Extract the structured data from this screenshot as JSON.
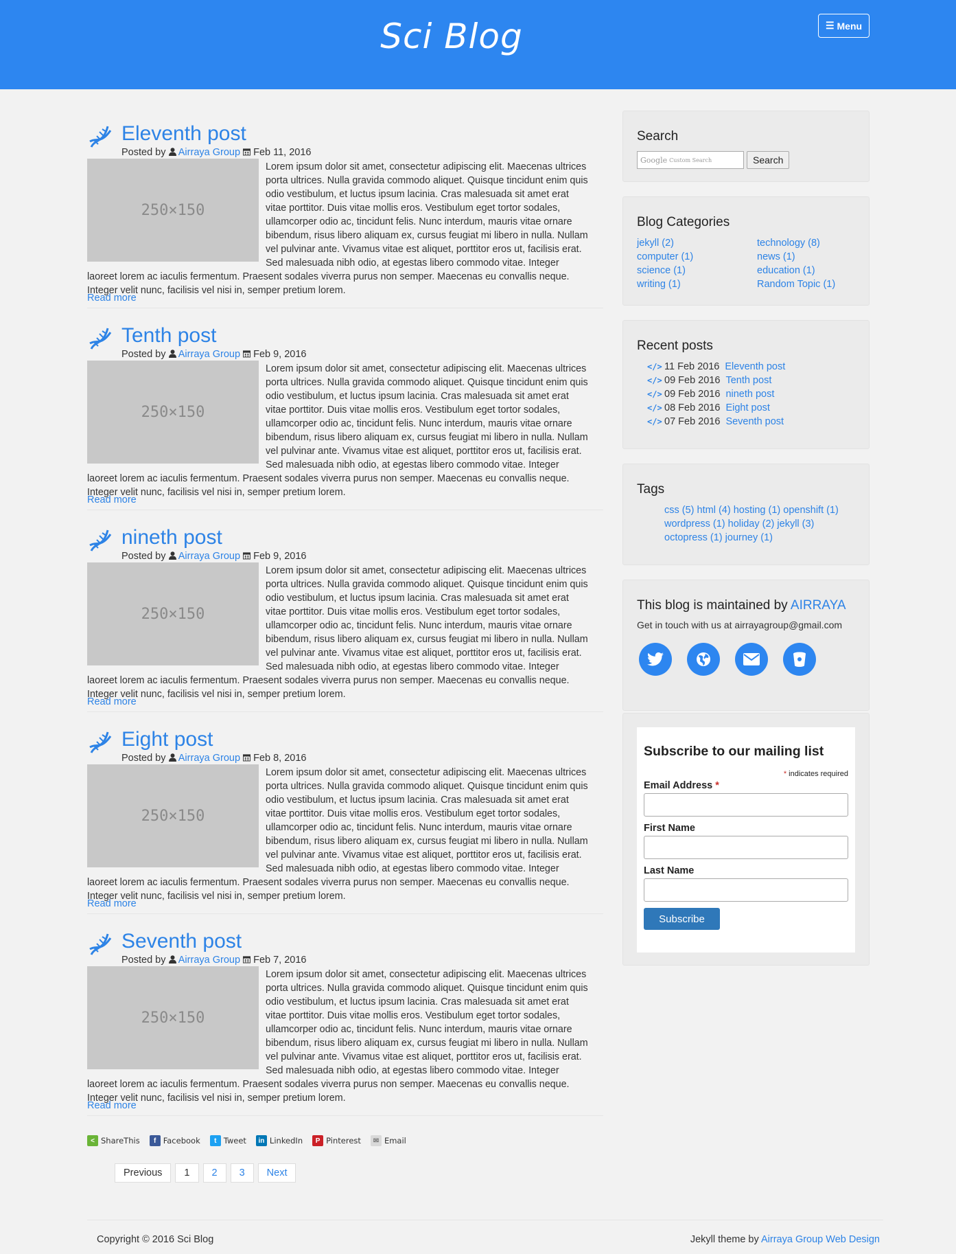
{
  "header": {
    "brand": "Sci Blog",
    "menu_label": "Menu"
  },
  "posts": [
    {
      "title": "Eleventh post",
      "posted_by_label": "Posted by",
      "author": "Airraya Group",
      "date": "Feb 11, 2016",
      "thumb_text": "250×150",
      "excerpt": "Lorem ipsum dolor sit amet, consectetur adipiscing elit. Maecenas ultrices porta ultrices. Nulla gravida commodo aliquet. Quisque tincidunt enim quis odio vestibulum, et luctus ipsum lacinia. Cras malesuada sit amet erat vitae porttitor. Duis vitae mollis eros. Vestibulum eget tortor sodales, ullamcorper odio ac, tincidunt felis. Nunc interdum, mauris vitae ornare bibendum, risus libero aliquam ex, cursus feugiat mi libero in nulla. Nullam vel pulvinar ante. Vivamus vitae est aliquet, porttitor eros ut, facilisis erat. Sed malesuada nibh odio, at egestas libero commodo vitae. Integer laoreet lorem ac iaculis fermentum. Praesent sodales viverra purus non semper. Maecenas eu convallis neque. Integer velit nunc, facilisis vel nisi in, semper pretium lorem.",
      "read_more": "Read more"
    },
    {
      "title": "Tenth post",
      "posted_by_label": "Posted by",
      "author": "Airraya Group",
      "date": "Feb 9, 2016",
      "thumb_text": "250×150",
      "excerpt": "Lorem ipsum dolor sit amet, consectetur adipiscing elit. Maecenas ultrices porta ultrices. Nulla gravida commodo aliquet. Quisque tincidunt enim quis odio vestibulum, et luctus ipsum lacinia. Cras malesuada sit amet erat vitae porttitor. Duis vitae mollis eros. Vestibulum eget tortor sodales, ullamcorper odio ac, tincidunt felis. Nunc interdum, mauris vitae ornare bibendum, risus libero aliquam ex, cursus feugiat mi libero in nulla. Nullam vel pulvinar ante. Vivamus vitae est aliquet, porttitor eros ut, facilisis erat. Sed malesuada nibh odio, at egestas libero commodo vitae. Integer laoreet lorem ac iaculis fermentum. Praesent sodales viverra purus non semper. Maecenas eu convallis neque. Integer velit nunc, facilisis vel nisi in, semper pretium lorem.",
      "read_more": "Read more"
    },
    {
      "title": "nineth post",
      "posted_by_label": "Posted by",
      "author": "Airraya Group",
      "date": "Feb 9, 2016",
      "thumb_text": "250×150",
      "excerpt": "Lorem ipsum dolor sit amet, consectetur adipiscing elit. Maecenas ultrices porta ultrices. Nulla gravida commodo aliquet. Quisque tincidunt enim quis odio vestibulum, et luctus ipsum lacinia. Cras malesuada sit amet erat vitae porttitor. Duis vitae mollis eros. Vestibulum eget tortor sodales, ullamcorper odio ac, tincidunt felis. Nunc interdum, mauris vitae ornare bibendum, risus libero aliquam ex, cursus feugiat mi libero in nulla. Nullam vel pulvinar ante. Vivamus vitae est aliquet, porttitor eros ut, facilisis erat. Sed malesuada nibh odio, at egestas libero commodo vitae. Integer laoreet lorem ac iaculis fermentum. Praesent sodales viverra purus non semper. Maecenas eu convallis neque. Integer velit nunc, facilisis vel nisi in, semper pretium lorem.",
      "read_more": "Read more"
    },
    {
      "title": "Eight post",
      "posted_by_label": "Posted by",
      "author": "Airraya Group",
      "date": "Feb 8, 2016",
      "thumb_text": "250×150",
      "excerpt": "Lorem ipsum dolor sit amet, consectetur adipiscing elit. Maecenas ultrices porta ultrices. Nulla gravida commodo aliquet. Quisque tincidunt enim quis odio vestibulum, et luctus ipsum lacinia. Cras malesuada sit amet erat vitae porttitor. Duis vitae mollis eros. Vestibulum eget tortor sodales, ullamcorper odio ac, tincidunt felis. Nunc interdum, mauris vitae ornare bibendum, risus libero aliquam ex, cursus feugiat mi libero in nulla. Nullam vel pulvinar ante. Vivamus vitae est aliquet, porttitor eros ut, facilisis erat. Sed malesuada nibh odio, at egestas libero commodo vitae. Integer laoreet lorem ac iaculis fermentum. Praesent sodales viverra purus non semper. Maecenas eu convallis neque. Integer velit nunc, facilisis vel nisi in, semper pretium lorem.",
      "read_more": "Read more"
    },
    {
      "title": "Seventh post",
      "posted_by_label": "Posted by",
      "author": "Airraya Group",
      "date": "Feb 7, 2016",
      "thumb_text": "250×150",
      "excerpt": "Lorem ipsum dolor sit amet, consectetur adipiscing elit. Maecenas ultrices porta ultrices. Nulla gravida commodo aliquet. Quisque tincidunt enim quis odio vestibulum, et luctus ipsum lacinia. Cras malesuada sit amet erat vitae porttitor. Duis vitae mollis eros. Vestibulum eget tortor sodales, ullamcorper odio ac, tincidunt felis. Nunc interdum, mauris vitae ornare bibendum, risus libero aliquam ex, cursus feugiat mi libero in nulla. Nullam vel pulvinar ante. Vivamus vitae est aliquet, porttitor eros ut, facilisis erat. Sed malesuada nibh odio, at egestas libero commodo vitae. Integer laoreet lorem ac iaculis fermentum. Praesent sodales viverra purus non semper. Maecenas eu convallis neque. Integer velit nunc, facilisis vel nisi in, semper pretium lorem.",
      "read_more": "Read more"
    }
  ],
  "share": {
    "items": [
      {
        "label": "ShareThis",
        "icon": "sharethis-icon",
        "color": "#6ab437"
      },
      {
        "label": "Facebook",
        "icon": "facebook-icon",
        "color": "#3b5998"
      },
      {
        "label": "Tweet",
        "icon": "twitter-icon",
        "color": "#1da1f2"
      },
      {
        "label": "LinkedIn",
        "icon": "linkedin-icon",
        "color": "#0077b5"
      },
      {
        "label": "Pinterest",
        "icon": "pinterest-icon",
        "color": "#cb2027"
      },
      {
        "label": "Email",
        "icon": "email-icon",
        "color": "#d9d9d9"
      }
    ]
  },
  "pagination": {
    "previous": "Previous",
    "pages": [
      "1",
      "2",
      "3"
    ],
    "next": "Next"
  },
  "sidebar": {
    "search": {
      "title": "Search",
      "placeholder": "Custom Search",
      "google_label": "Google",
      "button": "Search"
    },
    "categories": {
      "title": "Blog Categories",
      "items": [
        "jekyll (2)",
        "technology (8)",
        "computer (1)",
        "news (1)",
        "science (1)",
        "education (1)",
        "writing (1)",
        "Random Topic (1)"
      ]
    },
    "recent": {
      "title": "Recent posts",
      "items": [
        {
          "date": "11 Feb 2016",
          "title": "Eleventh post"
        },
        {
          "date": "09 Feb 2016",
          "title": "Tenth post"
        },
        {
          "date": "09 Feb 2016",
          "title": "nineth post"
        },
        {
          "date": "08 Feb 2016",
          "title": "Eight post"
        },
        {
          "date": "07 Feb 2016",
          "title": "Seventh post"
        }
      ]
    },
    "tags": {
      "title": "Tags",
      "items": [
        "css (5)",
        "html (4)",
        "hosting (1)",
        "openshift (1)",
        "wordpress (1)",
        "holiday (2)",
        "jekyll (3)",
        "octopress (1)",
        "journey (1)"
      ]
    },
    "maintainer": {
      "prefix": "This blog is maintained by",
      "name": "AIRRAYA",
      "contact": "Get in touch with us at airrayagroup@gmail.com",
      "social": [
        "twitter-icon",
        "globe-icon",
        "envelope-icon",
        "bucket-icon"
      ]
    },
    "mailchimp": {
      "title": "Subscribe to our mailing list",
      "required_note": "indicates required",
      "required_mark": "*",
      "email_label": "Email Address",
      "first_label": "First Name",
      "last_label": "Last Name",
      "submit": "Subscribe"
    }
  },
  "footer": {
    "copyright": "Copyright © 2016 Sci Blog",
    "theme_prefix": "Jekyll theme by",
    "theme_link": "Airraya Group Web Design"
  },
  "colors": {
    "accent": "#2d86f0",
    "link": "#2d83e6",
    "subscribe_button": "#2f78b9"
  }
}
